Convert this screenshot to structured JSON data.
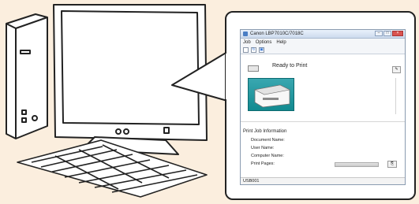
{
  "printer_window": {
    "title": "Canon LBP7010C/7018C",
    "menu": [
      "Job",
      "Options",
      "Help"
    ],
    "toolbar_icons": [
      "new-icon",
      "refresh-icon",
      "printer-icon"
    ],
    "status": "Ready to Print",
    "info_section": {
      "title": "Print Job Information",
      "rows": [
        "Document Name:",
        "User Name:",
        "Computer Name:",
        "Print Pages:"
      ]
    },
    "port": "USB001"
  },
  "colors": {
    "background": "#fbeede",
    "outline": "#222222",
    "printer_image_bg": "#1d97a0"
  }
}
